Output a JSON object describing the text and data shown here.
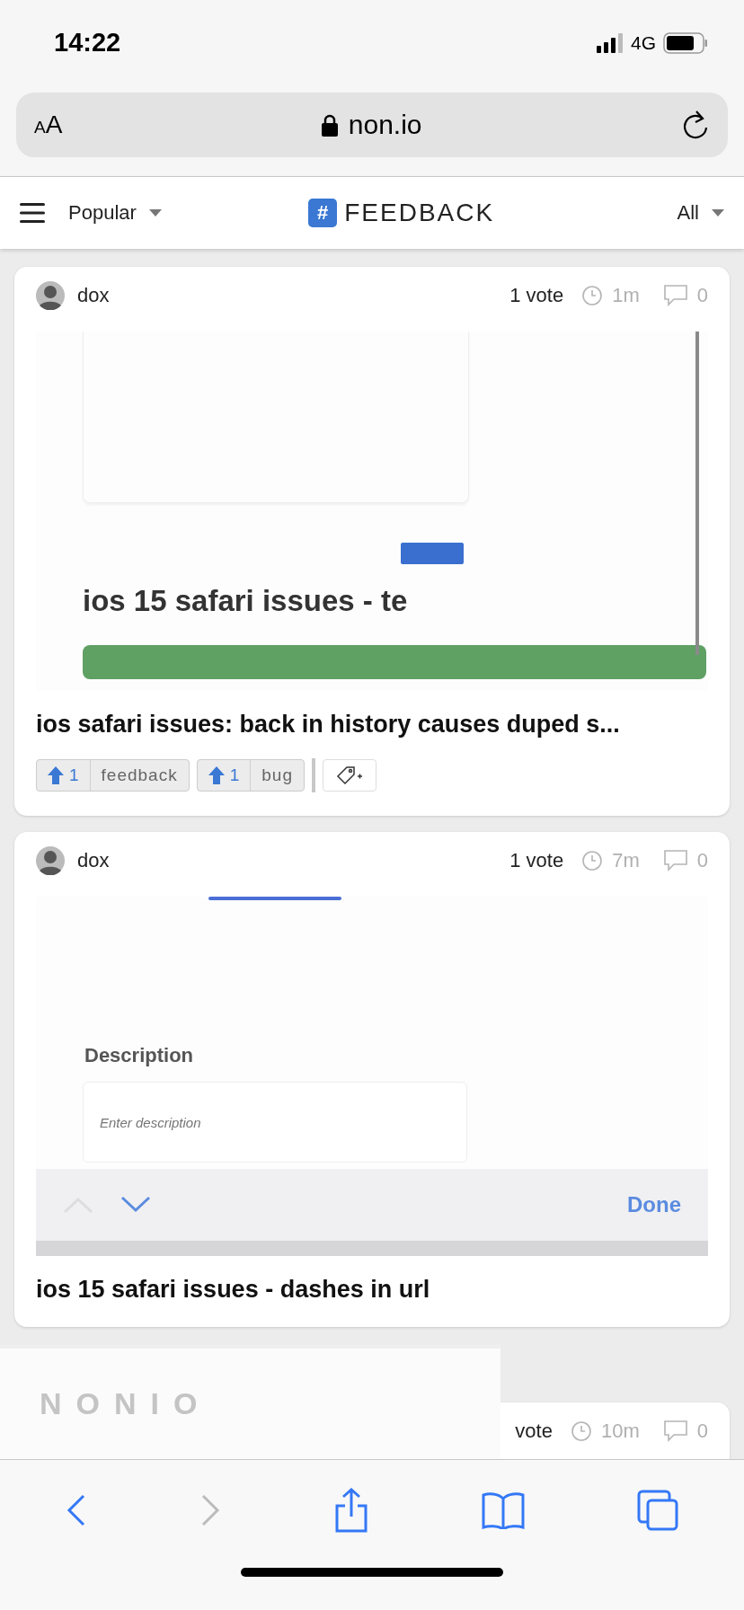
{
  "status_bar": {
    "time": "14:22",
    "network": "4G"
  },
  "address_bar": {
    "text_size_small": "A",
    "text_size_large": "A",
    "url": "non.io"
  },
  "nav": {
    "sort": "Popular",
    "tag_symbol": "#",
    "tag": "FEEDBACK",
    "filter": "All"
  },
  "posts": [
    {
      "author": "dox",
      "votes": "1 vote",
      "time": "1m",
      "comments": "0",
      "screenshot": {
        "kind": "page",
        "heading": "ios 15 safari issues - te"
      },
      "title": "ios safari issues: back in history causes duped s...",
      "tags": [
        {
          "votes": "1",
          "label": "feedback"
        },
        {
          "votes": "1",
          "label": "bug"
        }
      ]
    },
    {
      "author": "dox",
      "votes": "1 vote",
      "time": "7m",
      "comments": "0",
      "screenshot": {
        "kind": "form",
        "label": "Description",
        "placeholder": "Enter description",
        "done": "Done"
      },
      "title": "ios 15 safari issues - dashes in url"
    },
    {
      "votes": "vote",
      "time": "10m",
      "comments": "0"
    }
  ],
  "footer_logo": "NONIO"
}
